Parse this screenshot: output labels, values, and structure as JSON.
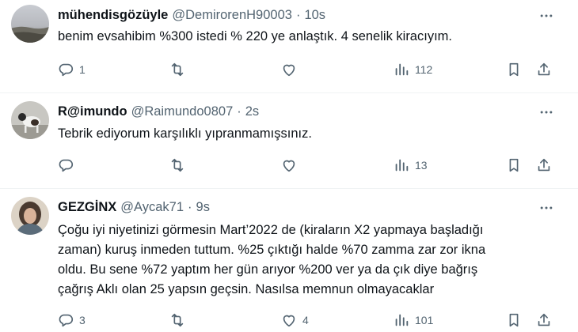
{
  "tweets": [
    {
      "name": "mühendisgözüyle",
      "handle": "@DemirorenH90003",
      "dot": "·",
      "time": "10s",
      "text": "benim evsahibim %300 istedi % 220 ye anlaştık. 4 senelik kiracıyım.",
      "reply_count": "1",
      "retweet_count": "",
      "like_count": "",
      "views_count": "112"
    },
    {
      "name": "R@imundo",
      "handle": "@Raimundo0807",
      "dot": "·",
      "time": "2s",
      "text": "Tebrik ediyorum karşılıklı yıpranmamışsınız.",
      "reply_count": "",
      "retweet_count": "",
      "like_count": "",
      "views_count": "13"
    },
    {
      "name": "GEZGİNX",
      "handle": "@Aycak71",
      "dot": "·",
      "time": "9s",
      "lines": [
        "Çoğu iyi niyetinizi görmesin Mart’2022 de (kiraların X2 yapmaya başladığı",
        "zaman) kuruş inmeden tuttum. %25 çıktığı halde %70 zamma zar zor ikna",
        "oldu. Bu sene %72 yaptım her gün arıyor  %200  ver ya da çık diye bağrış",
        "çağrış Aklı olan 25 yapsın geçsin. Nasılsa memnun olmayacaklar"
      ],
      "reply_count": "3",
      "retweet_count": "",
      "like_count": "4",
      "views_count": "101"
    }
  ],
  "icons": {
    "more": "more-horizontal-icon",
    "reply": "reply-icon",
    "retweet": "retweet-icon",
    "like": "heart-icon",
    "views": "views-chart-icon",
    "bookmark": "bookmark-icon",
    "share": "share-icon"
  },
  "colors": {
    "text": "#0f1419",
    "secondary": "#536471",
    "divider": "#eff3f4"
  }
}
